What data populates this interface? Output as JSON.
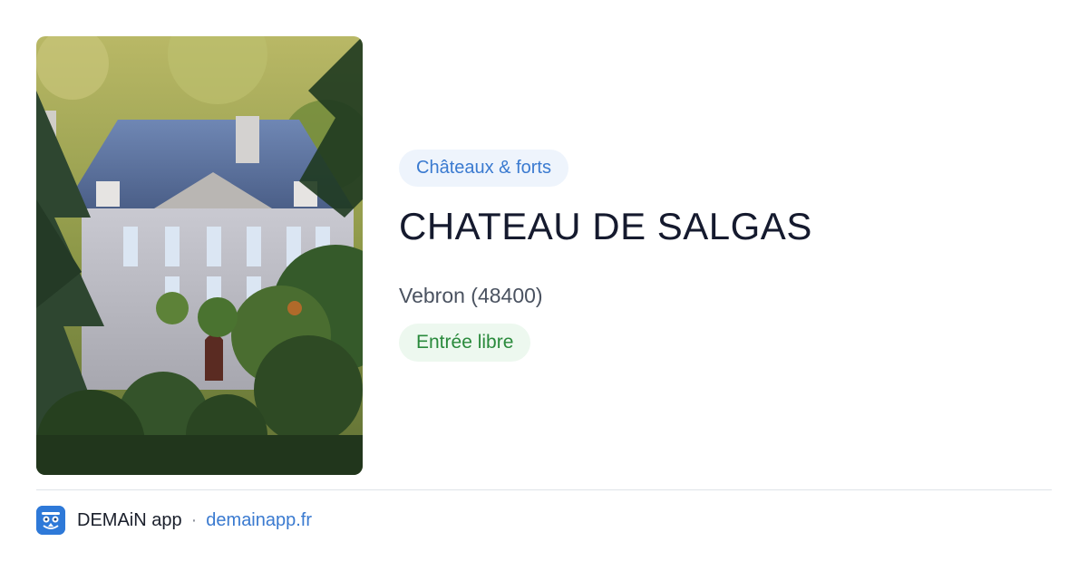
{
  "card": {
    "category": "Châteaux & forts",
    "title": "CHATEAU DE SALGAS",
    "location": "Vebron (48400)",
    "price": "Entrée libre"
  },
  "footer": {
    "app_name": "DEMAiN app",
    "separator": "·",
    "domain": "demainapp.fr"
  },
  "colors": {
    "category_bg": "#eef4fc",
    "category_text": "#3a7ad0",
    "price_bg": "#edf8ef",
    "price_text": "#2a8a3c",
    "title_text": "#151a2e",
    "app_icon_bg": "#2e79d8"
  },
  "icons": {
    "app": "demain-app-icon"
  }
}
